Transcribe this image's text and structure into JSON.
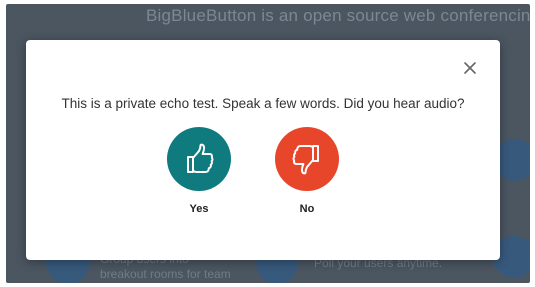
{
  "background": {
    "heading": "BigBlueButton is an open source web conferencing sy",
    "feature_breakout_line1": "Group users into",
    "feature_breakout_line2": "breakout rooms for team",
    "feature_poll": "Poll your users anytime."
  },
  "dialog": {
    "prompt": "This is a private echo test. Speak a few words. Did you hear audio?",
    "yes_label": "Yes",
    "no_label": "No",
    "close_icon": "close-icon",
    "yes_icon": "thumbs-up-icon",
    "no_icon": "thumbs-down-icon"
  },
  "colors": {
    "yes_button": "#0f7b7f",
    "no_button": "#e8462a",
    "overlay": "#4b5661"
  }
}
